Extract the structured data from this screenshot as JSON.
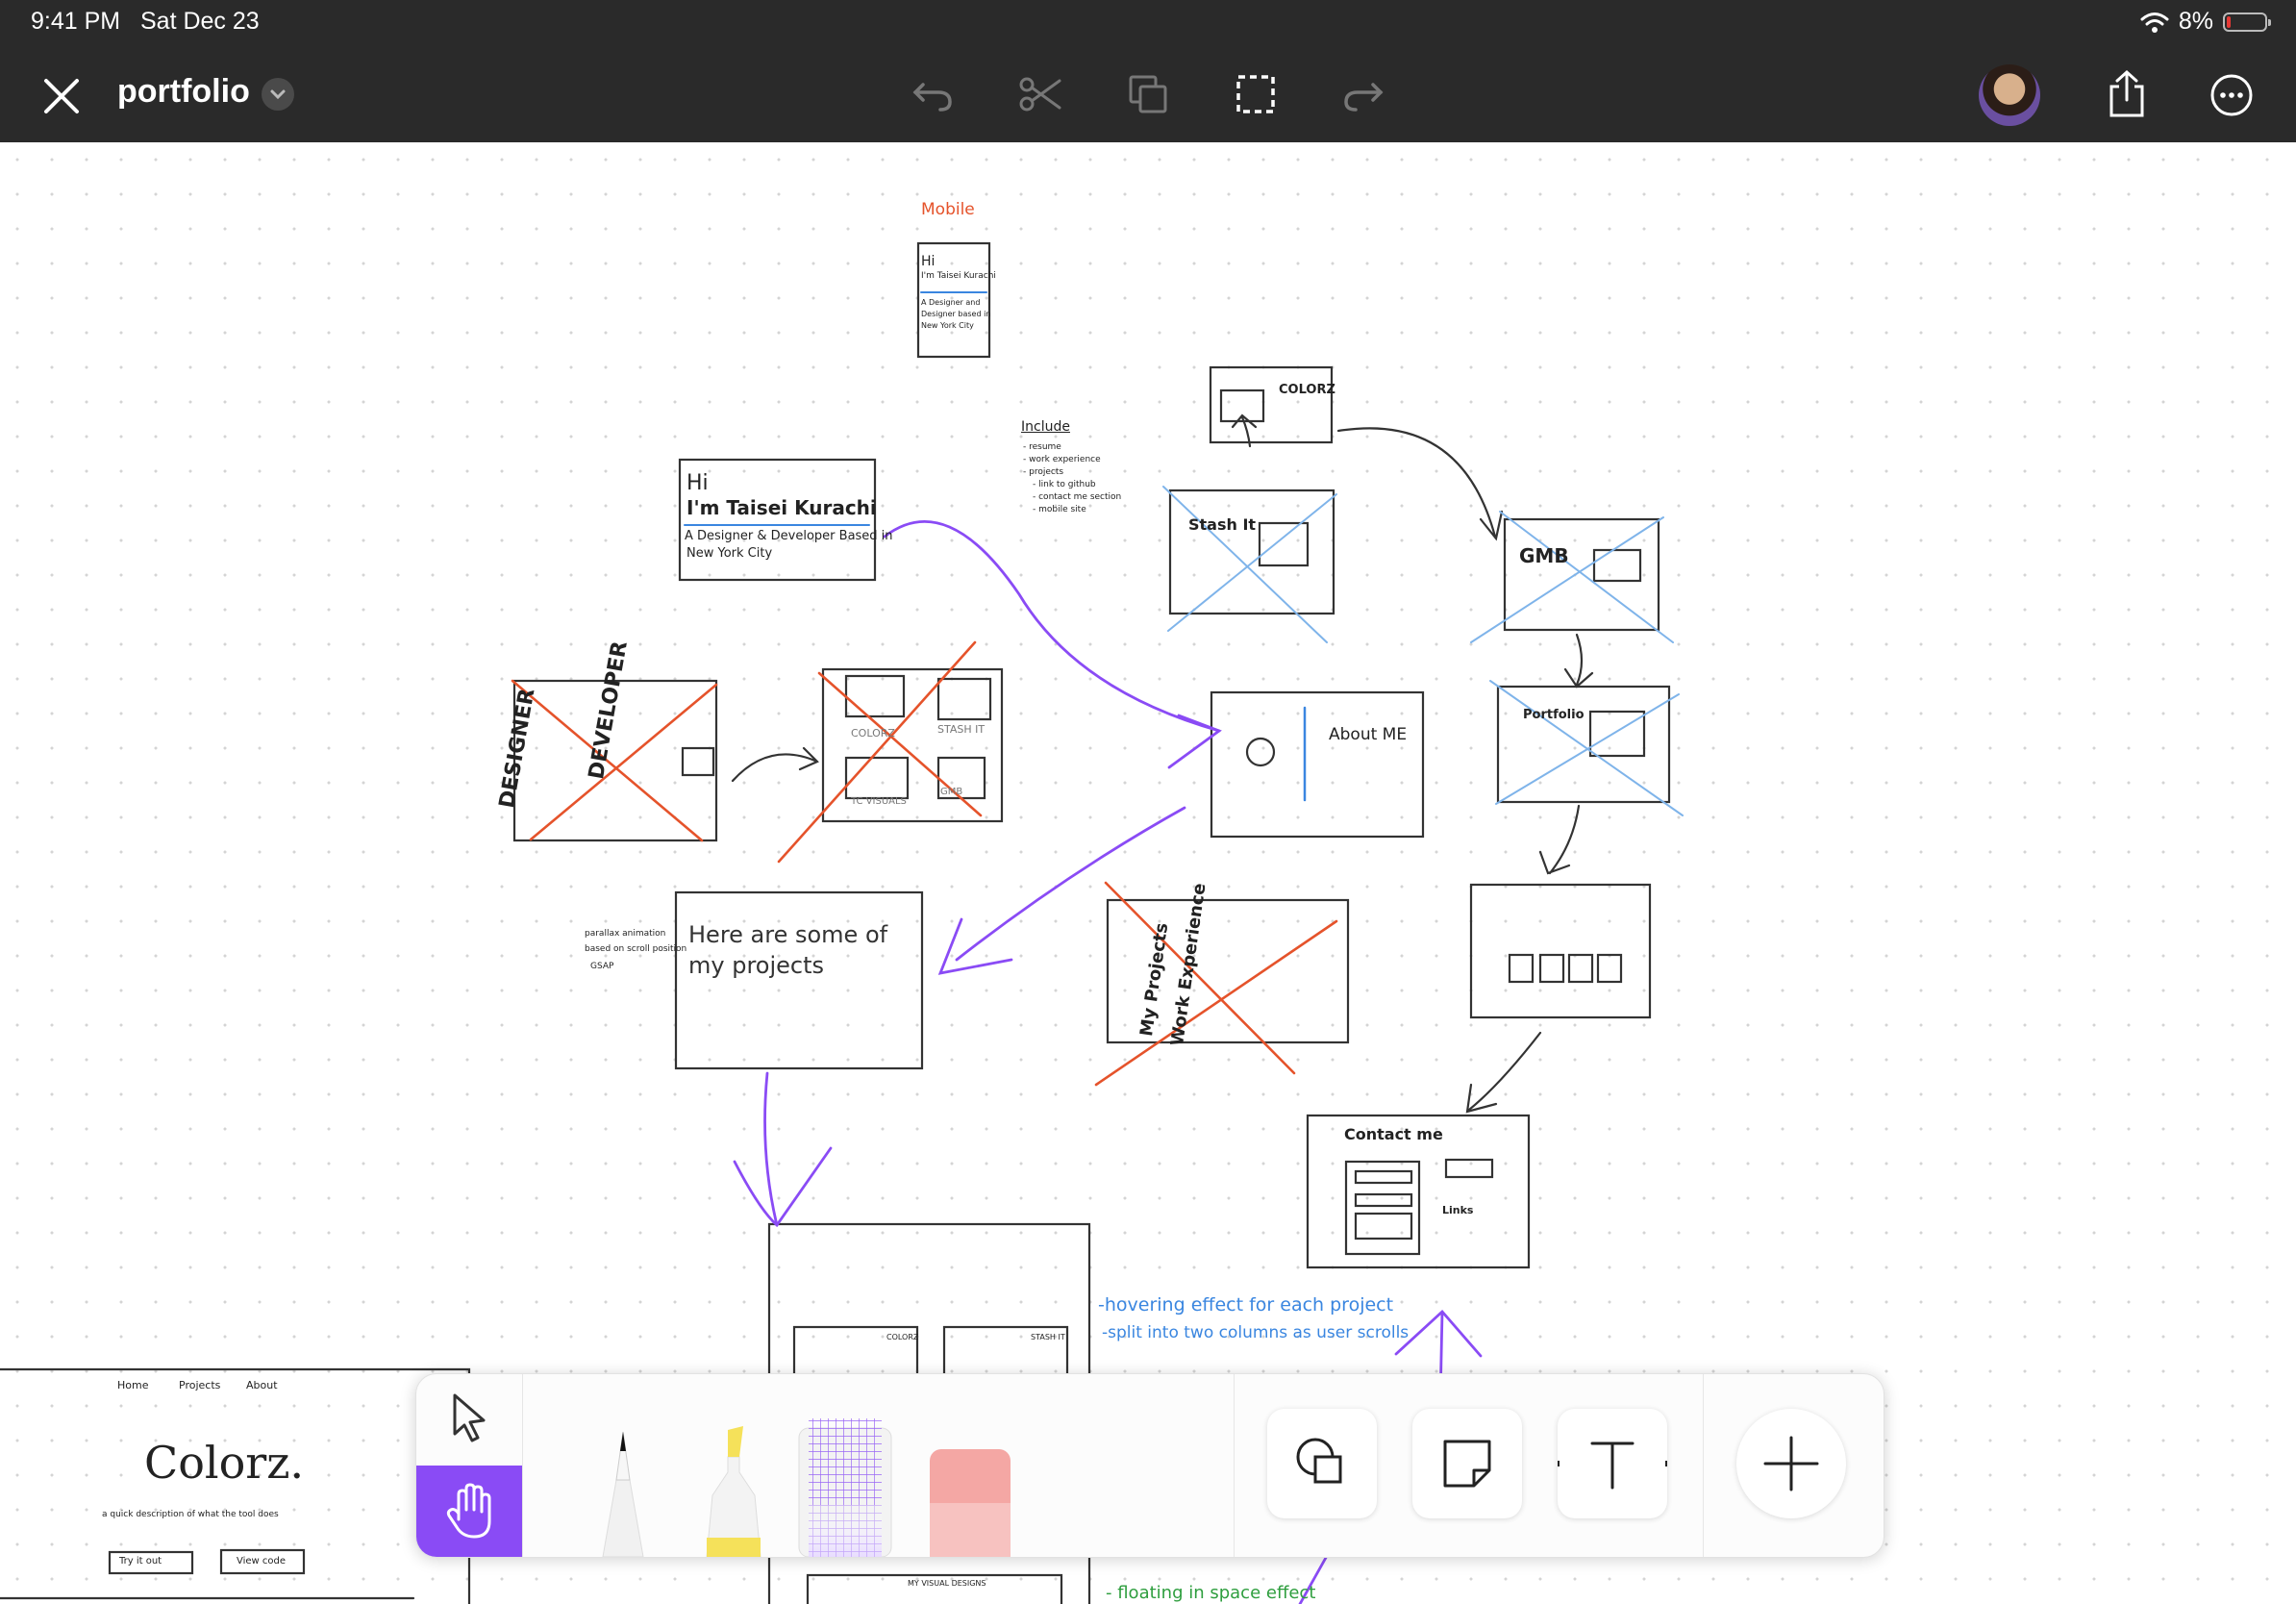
{
  "status_bar": {
    "time": "9:41 PM",
    "date": "Sat Dec 23",
    "battery": "8%",
    "battery_level": 0.08
  },
  "header": {
    "title": "portfolio",
    "icons": [
      "close-icon",
      "chevron-down-icon",
      "undo-icon",
      "scissors-icon",
      "duplicate-icon",
      "selection-icon",
      "redo-icon",
      "avatar",
      "share-icon",
      "more-icon"
    ]
  },
  "colors": {
    "bar": "#2a2a2a",
    "accent": "#8a4bf5",
    "purple_ink": "#8a4bf5",
    "red_ink": "#e5532b",
    "blue_ink": "#3a86e0",
    "green_ink": "#2e9e3e"
  },
  "board": {
    "notes": {
      "mobile": "Mobile",
      "include": "Include",
      "include_items": [
        "- resume",
        "- work experience",
        "- projects",
        "- link to github",
        "- contact me section",
        "- mobile site"
      ],
      "mobile_hi": "Hi",
      "mobile_name": "I'm Taisei Kurachi",
      "mobile_desc1": "A Designer and",
      "mobile_desc2": "Designer based in",
      "mobile_desc3": "New York City",
      "hero_hi": "Hi",
      "hero_name": "I'm Taisei Kurachi",
      "hero_desc1": "A Designer & Developer Based in",
      "hero_desc2": "New York City",
      "designer": "DESIGNER",
      "developer": "DEVELOPER",
      "colorz_box": "COLORZ",
      "stashit_box": "STASH IT",
      "tc_visuals": "TC VISUALS",
      "gmb_box": "GMB",
      "colorz": "COLORZ",
      "stash_it": "Stash It",
      "gmb": "GMB",
      "portfolio": "Portfolio",
      "about_me": "About ME",
      "projects_line1": "Here are some of",
      "projects_line2": "my projects",
      "parallax1": "parallax animation",
      "parallax2": "based on scroll position",
      "parallax3": "GSAP",
      "my_projects": "My Projects",
      "work_experience": "Work Experience",
      "contact_me": "Contact me",
      "links": "Links",
      "hover_note1": "-hovering effect for each project",
      "hover_note2": "-split into two columns as user scrolls",
      "floating_note": "- floating in space effect",
      "colorz_big": "Colorz.",
      "nav_home": "Home",
      "nav_projects": "Projects",
      "nav_about": "About",
      "try_it": "Try it out",
      "view_code": "View code",
      "colorz_desc": "a quick description of what the tool does",
      "stash_it_small": "STASH IT",
      "my_visual_designs": "MY VISUAL DESIGNS"
    }
  },
  "toolbar": {
    "tools": [
      "select-icon",
      "hand-icon",
      "pen-tool",
      "highlighter-tool",
      "pattern-tool",
      "eraser-tool",
      "shapes-icon",
      "sticky-note-icon",
      "text-icon",
      "add-icon"
    ],
    "active_tool": "hand-icon"
  }
}
